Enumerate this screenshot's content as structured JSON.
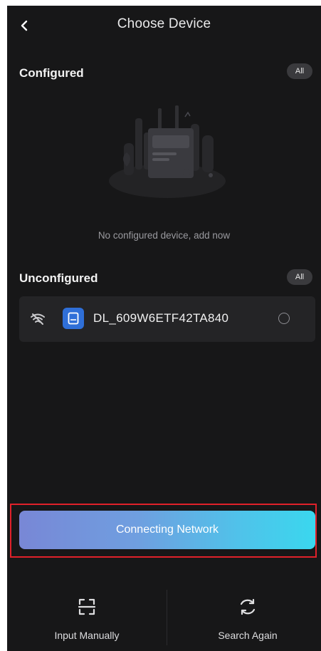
{
  "header": {
    "title": "Choose Device",
    "back_icon": "chevron-left-icon"
  },
  "configured": {
    "title": "Configured",
    "all_label": "All",
    "empty_text": "No configured device, add now"
  },
  "unconfigured": {
    "title": "Unconfigured",
    "all_label": "All",
    "devices": [
      {
        "name": "DL_609W6ETF42TA840",
        "signal_icon": "wifi-icon",
        "type_icon": "device-icon",
        "selected": false
      }
    ]
  },
  "primary_action": {
    "label": "Connecting Network"
  },
  "bottom": {
    "input_manually": "Input Manually",
    "search_again": "Search Again"
  },
  "colors": {
    "background": "#171718",
    "card": "#242426",
    "device_badge": "#2f6fd8",
    "gradient_start": "#7887d6",
    "gradient_end": "#3ad7ee",
    "highlight": "#e0212a"
  }
}
